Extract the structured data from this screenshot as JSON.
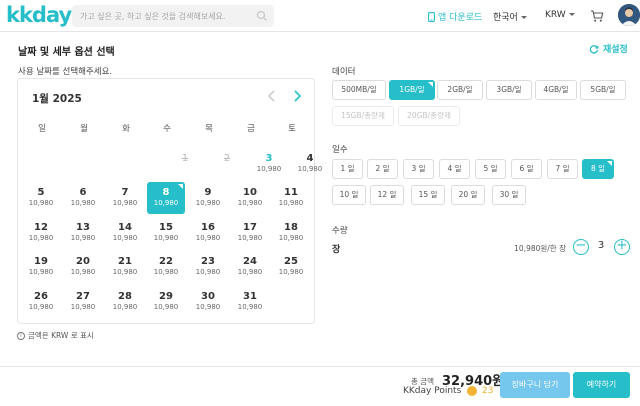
{
  "header": {
    "logo": "kkday",
    "search_placeholder": "가고 싶은 곳, 하고 싶은 것을 검색해보세요.",
    "app_download": "앱 다운로드",
    "language": "한국어",
    "currency": "KRW"
  },
  "section": {
    "title": "날짜 및 세부 옵션 선택",
    "reset": "재설정",
    "subtitle": "사용 날짜를 선택해주세요."
  },
  "calendar": {
    "month": "1월 2025",
    "weekdays": [
      "일",
      "월",
      "화",
      "수",
      "목",
      "금",
      "토"
    ],
    "price_label": "10,980",
    "days": {
      "d1": "1",
      "d2": "2",
      "d3": "3",
      "d4": "4",
      "d5": "5",
      "d6": "6",
      "d7": "7",
      "d8": "8",
      "d9": "9",
      "d10": "10",
      "d11": "11",
      "d12": "12",
      "d13": "13",
      "d14": "14",
      "d15": "15",
      "d16": "16",
      "d17": "17",
      "d18": "18",
      "d19": "19",
      "d20": "20",
      "d21": "21",
      "d22": "22",
      "d23": "23",
      "d24": "24",
      "d25": "25",
      "d26": "26",
      "d27": "27",
      "d28": "28",
      "d29": "29",
      "d30": "30",
      "d31": "31"
    },
    "selected_day": "8",
    "note": "금액은 KRW 로 표시"
  },
  "options": {
    "data_label": "데이터",
    "data": {
      "o1": "500MB/일",
      "o2": "1GB/일",
      "o3": "2GB/일",
      "o4": "3GB/일",
      "o5": "4GB/일",
      "o6": "5GB/일",
      "o7": "15GB/총량제",
      "o8": "20GB/총량제"
    },
    "data_selected": "1GB/일",
    "days_label": "일수",
    "days": {
      "a1": "1 일",
      "a2": "2 일",
      "a3": "3 일",
      "a4": "4 일",
      "a5": "5 일",
      "a6": "6 일",
      "a7": "7 일",
      "a8": "8 일",
      "a9": "10 일",
      "a10": "12 일",
      "a11": "15 일",
      "a12": "20 일",
      "a13": "30 일"
    },
    "days_selected": "8 일",
    "quantity_label": "수량",
    "unit": "장",
    "unit_price": "10,980원/한 장",
    "quantity": "3",
    "minus": "−",
    "plus": "+"
  },
  "footer": {
    "total_label": "총 금액",
    "total_value": "32,940원",
    "points_label": "KKday Points",
    "points_value": "23",
    "cart_button": "장바구니 담기",
    "book_button": "예약하기"
  },
  "colors": {
    "accent": "#26bec9",
    "cart_button": "#76c7ee",
    "points": "#f2b233"
  }
}
